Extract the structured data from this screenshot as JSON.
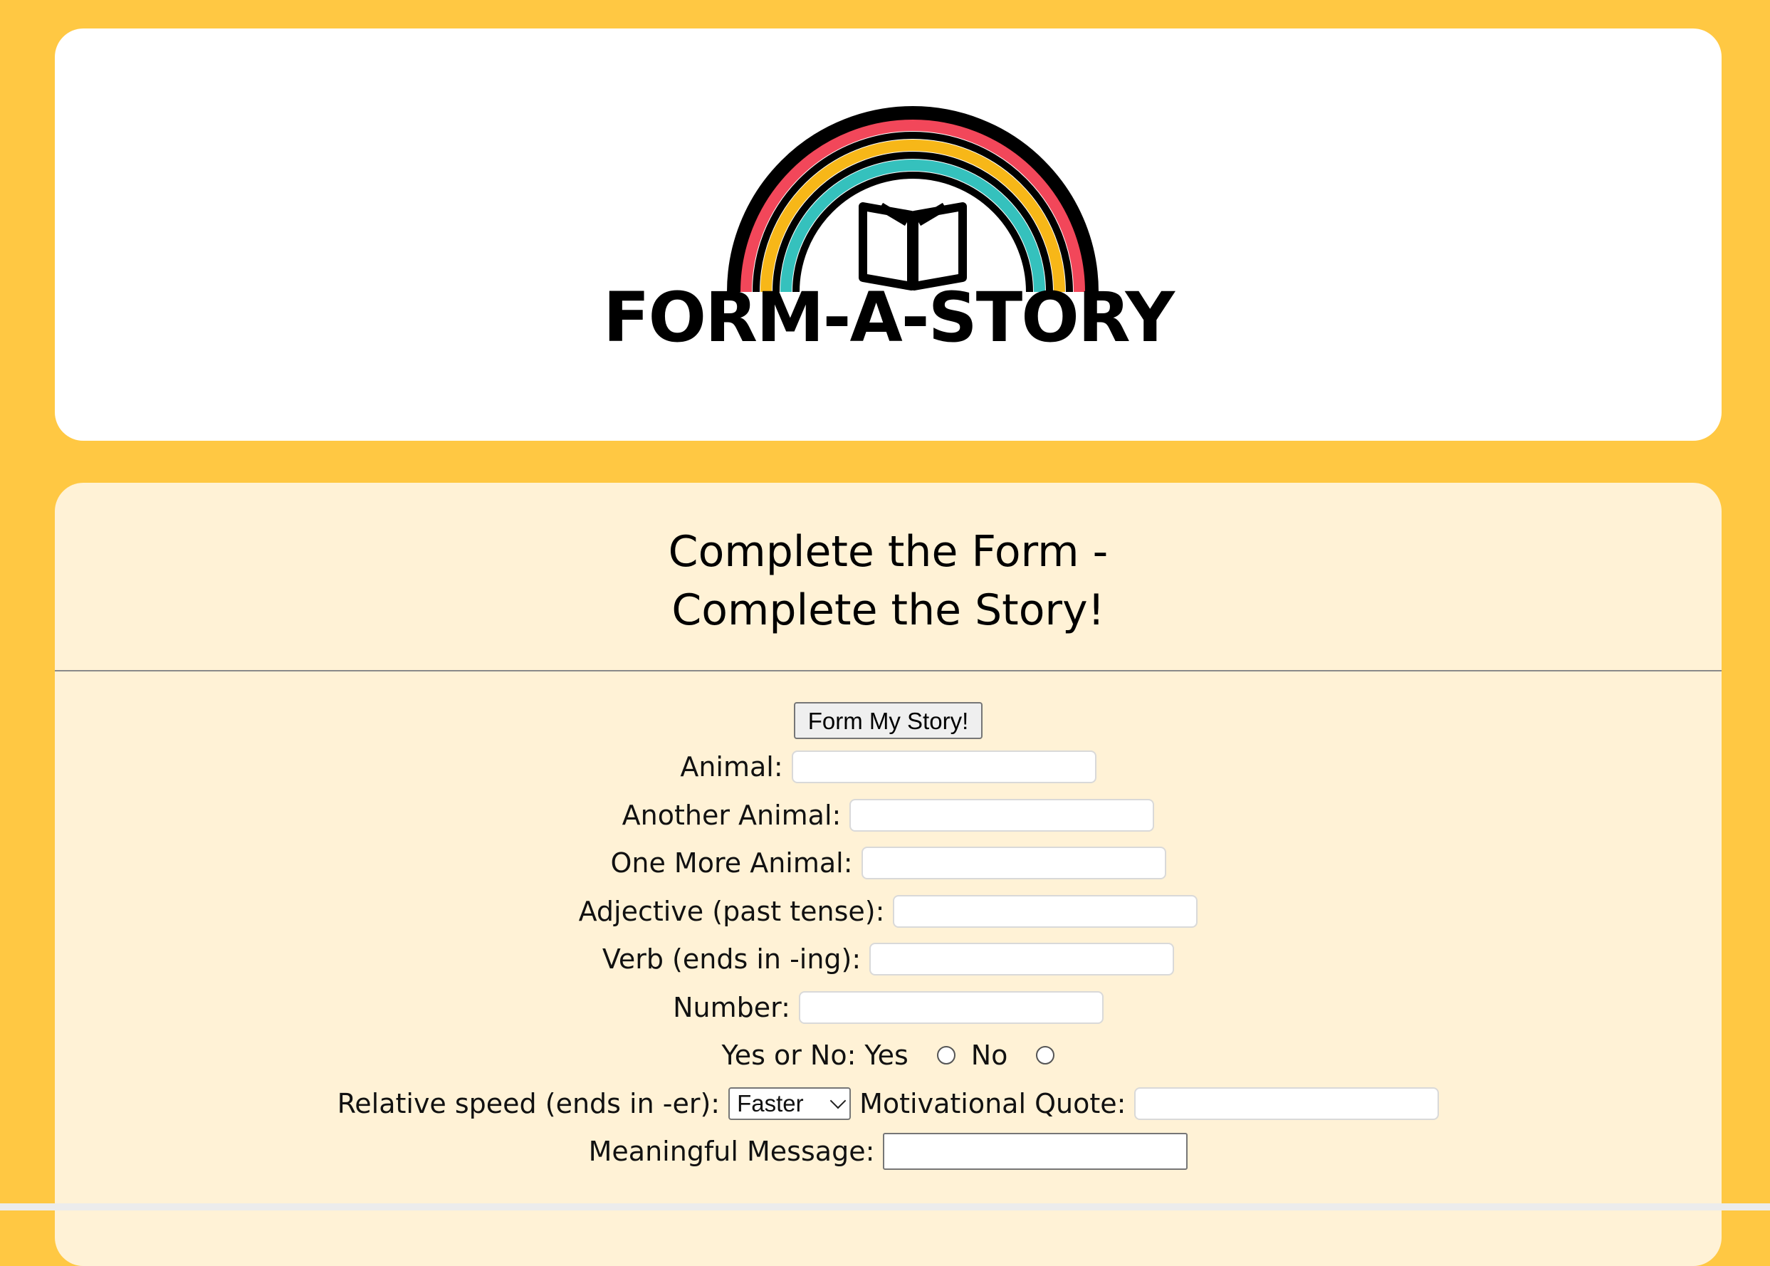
{
  "header": {
    "logo_text": "FORM-A-STORY",
    "logo_icon": "rainbow-book-icon",
    "colors": {
      "rainbow_red": "#f2475a",
      "rainbow_yellow": "#f7b718",
      "rainbow_teal": "#35c1bd",
      "page_background": "#ffc843",
      "form_background": "#fff2d6"
    }
  },
  "form": {
    "title_line1": "Complete the Form -",
    "title_line2": "Complete the Story!",
    "submit_label": "Form My Story!",
    "fields": {
      "animal_label": "Animal:",
      "another_animal_label": "Another Animal:",
      "one_more_animal_label": "One More Animal:",
      "adjective_label": "Adjective (past tense):",
      "verb_label": "Verb (ends in -ing):",
      "number_label": "Number:",
      "yes_no_label": "Yes or No:",
      "yes_option": "Yes",
      "no_option": "No",
      "relative_speed_label": "Relative speed (ends in -er):",
      "relative_speed_value": "Faster",
      "motivational_quote_label": "Motivational Quote:",
      "meaningful_message_label": "Meaningful Message:"
    }
  }
}
